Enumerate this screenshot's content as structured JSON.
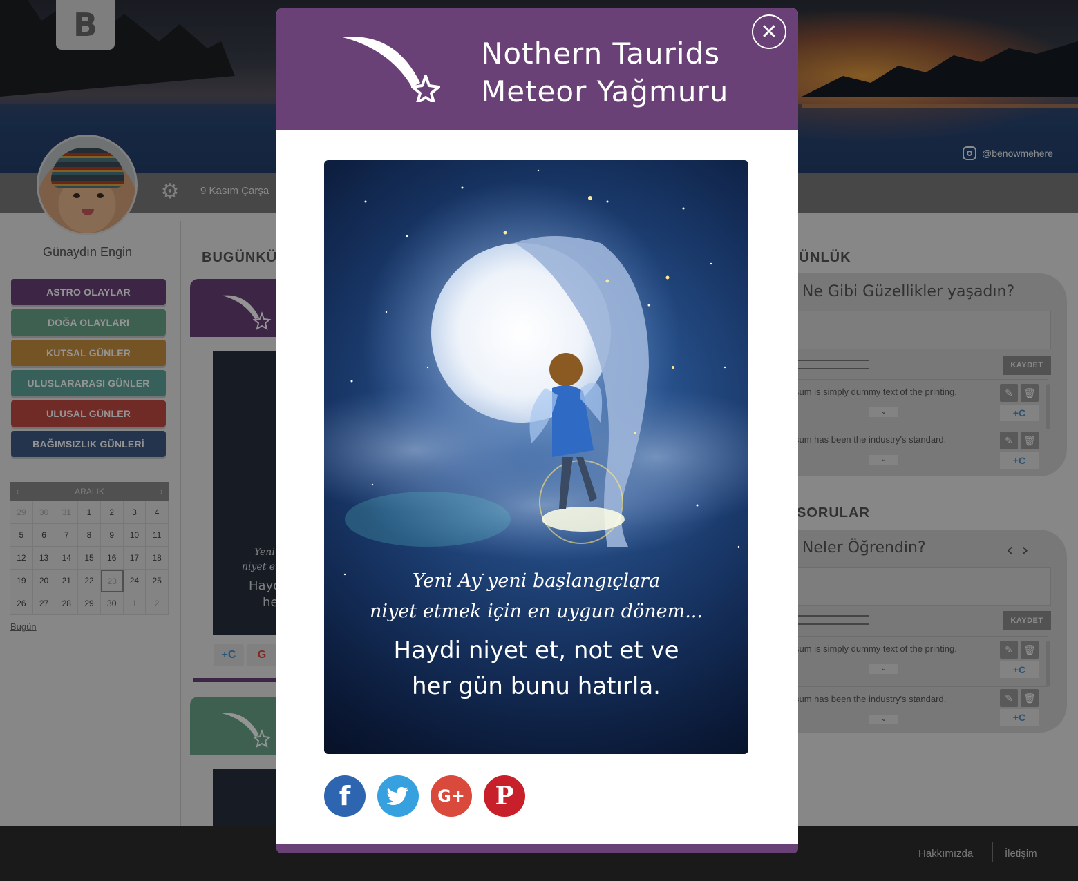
{
  "brand": {
    "logo_letter": "B",
    "instagram": "@benowmehere"
  },
  "topbar": {
    "date": "9 Kasım Çarşa"
  },
  "user": {
    "greeting": "Günaydın Engin"
  },
  "categories": [
    {
      "label": "ASTRO OLAYLAR",
      "color": "#6a4177"
    },
    {
      "label": "DOĞA OLAYLARI",
      "color": "#6aa68a"
    },
    {
      "label": "KUTSAL GÜNLER",
      "color": "#c9923e"
    },
    {
      "label": "ULUSLARARASI GÜNLER",
      "color": "#5fa69b"
    },
    {
      "label": "ULUSAL GÜNLER",
      "color": "#c24b43"
    },
    {
      "label": "BAĞIMSIZLIK GÜNLERİ",
      "color": "#3e5a86"
    }
  ],
  "calendar": {
    "month": "ARALIK",
    "prev_icon": "chevron-left-icon",
    "next_icon": "chevron-right-icon",
    "days": [
      "29",
      "30",
      "31",
      "1",
      "2",
      "3",
      "4",
      "5",
      "6",
      "7",
      "8",
      "9",
      "10",
      "11",
      "12",
      "13",
      "14",
      "15",
      "16",
      "17",
      "18",
      "19",
      "20",
      "21",
      "22",
      "23",
      "24",
      "25",
      "26",
      "27",
      "28",
      "29",
      "30",
      "1",
      "2"
    ],
    "today_link": "Bugün"
  },
  "middle": {
    "title": "BUGÜNKÜ",
    "card_text_1": "Yeni",
    "card_text_2": "niyet et",
    "card_text_3": "Haydi",
    "card_text_4": "her"
  },
  "right": {
    "journal_title": "GÜNLÜK",
    "journal_question": "n Ne Gibi Güzellikler yaşadın?",
    "questions_title": "SORULAR",
    "questions_question": "n Neler Öğrendin?",
    "save_label": "KAYDET",
    "note_1": "sum is simply dummy text of the printing.",
    "note_2": "sum has been the industry's standard."
  },
  "footer": {
    "about": "Hakkımızda",
    "contact": "İletişim"
  },
  "modal": {
    "title_line1": "Nothern Taurids",
    "title_line2": "Meteor Yağmuru",
    "header_color": "#6a4177",
    "poster": {
      "line1": "Yeni Ay yeni başlangıçlara",
      "line2": "niyet etmek için en uygun dönem...",
      "line3": "Haydi niyet et, not et ve",
      "line4": "her gün bunu hatırla."
    },
    "share": [
      {
        "network": "facebook",
        "glyph": "f",
        "color": "#2d65b0"
      },
      {
        "network": "twitter",
        "glyph": "t",
        "color": "#37a1e0"
      },
      {
        "network": "google-plus",
        "glyph": "G+",
        "color": "#d94a3c"
      },
      {
        "network": "pinterest",
        "glyph": "P",
        "color": "#c8202a"
      }
    ]
  }
}
